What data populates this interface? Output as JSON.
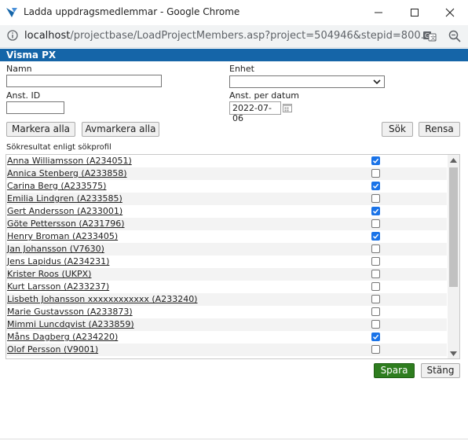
{
  "window": {
    "title": "Ladda uppdragsmedlemmar - Google Chrome",
    "url_host": "localhost",
    "url_rest": "/projectbase/LoadProjectMembers.asp?project=504946&stepid=800..."
  },
  "brand": "Visma PX",
  "form": {
    "name_label": "Namn",
    "name_value": "",
    "unit_label": "Enhet",
    "unit_value": "",
    "empid_label": "Anst. ID",
    "empid_value": "",
    "date_label": "Anst. per datum",
    "date_value": "2022-07-06"
  },
  "buttons": {
    "select_all": "Markera alla",
    "deselect_all": "Avmarkera alla",
    "search": "Sök",
    "clear": "Rensa",
    "save": "Spara",
    "close": "Stäng"
  },
  "results_label": "Sökresultat enligt sökprofil",
  "members": [
    {
      "name": "Anna Williamsson (A234051)",
      "checked": true
    },
    {
      "name": "Annica Stenberg (A233858)",
      "checked": false
    },
    {
      "name": "Carina Berg (A233575)",
      "checked": true
    },
    {
      "name": "Emilia Lindgren (A233585)",
      "checked": false
    },
    {
      "name": "Gert Andersson (A233001)",
      "checked": true
    },
    {
      "name": "Göte Pettersson (A231796)",
      "checked": false
    },
    {
      "name": "Henry Broman (A233405)",
      "checked": true
    },
    {
      "name": "Jan Johansson (V7630)",
      "checked": false
    },
    {
      "name": "Jens Lapidus (A234231)",
      "checked": false
    },
    {
      "name": "Krister Roos (UKPX)",
      "checked": false
    },
    {
      "name": "Kurt Larsson (A233237)",
      "checked": false
    },
    {
      "name": "Lisbeth Johansson xxxxxxxxxxxx (A233240)",
      "checked": false
    },
    {
      "name": "Marie Gustavsson (A233873)",
      "checked": false
    },
    {
      "name": "Mimmi Luncdqvist (A233859)",
      "checked": false
    },
    {
      "name": "Måns Dagberg (A234220)",
      "checked": true
    },
    {
      "name": "Olof Persson (V9001)",
      "checked": false
    }
  ],
  "colors": {
    "brand_bar": "#1565a8",
    "save_button": "#2e7d1f",
    "checkbox_checked": "#1a73e8"
  }
}
